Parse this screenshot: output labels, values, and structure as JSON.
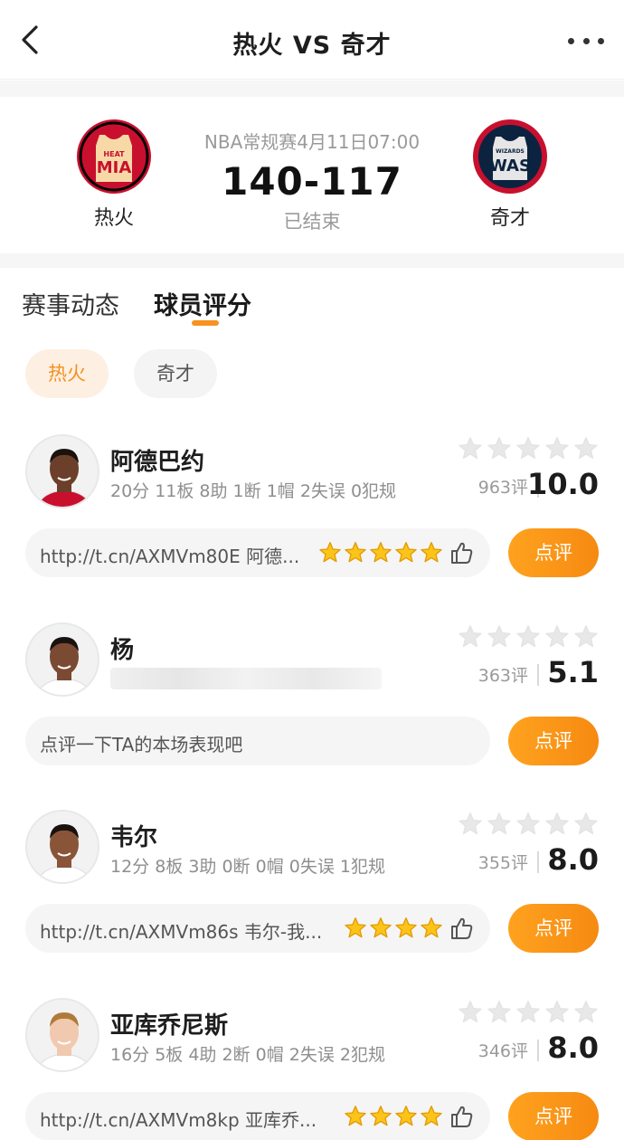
{
  "header": {
    "title": "热火 VS 奇才"
  },
  "match": {
    "league_time": "NBA常规赛4月11日07:00",
    "score": "140-117",
    "status": "已结束",
    "home": {
      "name": "热火",
      "logo_text": "MIA",
      "logo_sub": "HEAT"
    },
    "away": {
      "name": "奇才",
      "logo_text": "WAS",
      "logo_sub": "WIZARDS"
    }
  },
  "tabs": [
    {
      "label": "赛事动态"
    },
    {
      "label": "球员评分"
    }
  ],
  "team_filter": [
    {
      "label": "热火"
    },
    {
      "label": "奇才"
    }
  ],
  "rate_label": "点评",
  "players": [
    {
      "name": "阿德巴约",
      "stats": "20分 11板 8助 1断 1帽 2失误 0犯规",
      "count": "963评",
      "rating": "10.0",
      "comment": "http://t.cn/AXMVm80E 阿德...",
      "comment_stars": 5
    },
    {
      "name": "杨",
      "stats": "",
      "count": "363评",
      "rating": "5.1",
      "comment": "点评一下TA的本场表现吧",
      "comment_stars": 0
    },
    {
      "name": "韦尔",
      "stats": "12分 8板 3助 0断 0帽 0失误 1犯规",
      "count": "355评",
      "rating": "8.0",
      "comment": "http://t.cn/AXMVm86s 韦尔-我...",
      "comment_stars": 4
    },
    {
      "name": "亚库乔尼斯",
      "stats": "16分 5板 4助 2断 0帽 2失误 2犯规",
      "count": "346评",
      "rating": "8.0",
      "comment": "http://t.cn/AXMVm8kp 亚库乔...",
      "comment_stars": 4
    }
  ],
  "colors": {
    "accent": "#f7931e",
    "heat_red": "#c8102e",
    "wizards_navy": "#0c2340"
  }
}
